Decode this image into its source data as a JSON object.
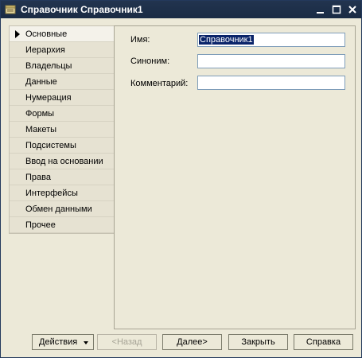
{
  "window": {
    "title": "Справочник Справочник1"
  },
  "sidebar": {
    "items": [
      {
        "label": "Основные",
        "active": true
      },
      {
        "label": "Иерархия"
      },
      {
        "label": "Владельцы"
      },
      {
        "label": "Данные"
      },
      {
        "label": "Нумерация"
      },
      {
        "label": "Формы"
      },
      {
        "label": "Макеты"
      },
      {
        "label": "Подсистемы"
      },
      {
        "label": "Ввод на основании"
      },
      {
        "label": "Права"
      },
      {
        "label": "Интерфейсы"
      },
      {
        "label": "Обмен данными"
      },
      {
        "label": "Прочее"
      }
    ]
  },
  "form": {
    "name_label": "Имя:",
    "name_value": "Справочник1",
    "synonym_label": "Синоним:",
    "synonym_value": "",
    "comment_label": "Комментарий:",
    "comment_value": ""
  },
  "buttons": {
    "actions": "Действия",
    "back": "<Назад",
    "next": "Далее>",
    "close": "Закрыть",
    "help": "Справка"
  },
  "colors": {
    "titlebar": "#1e3048",
    "selection": "#0a246a",
    "window_bg": "#ece9d8"
  }
}
